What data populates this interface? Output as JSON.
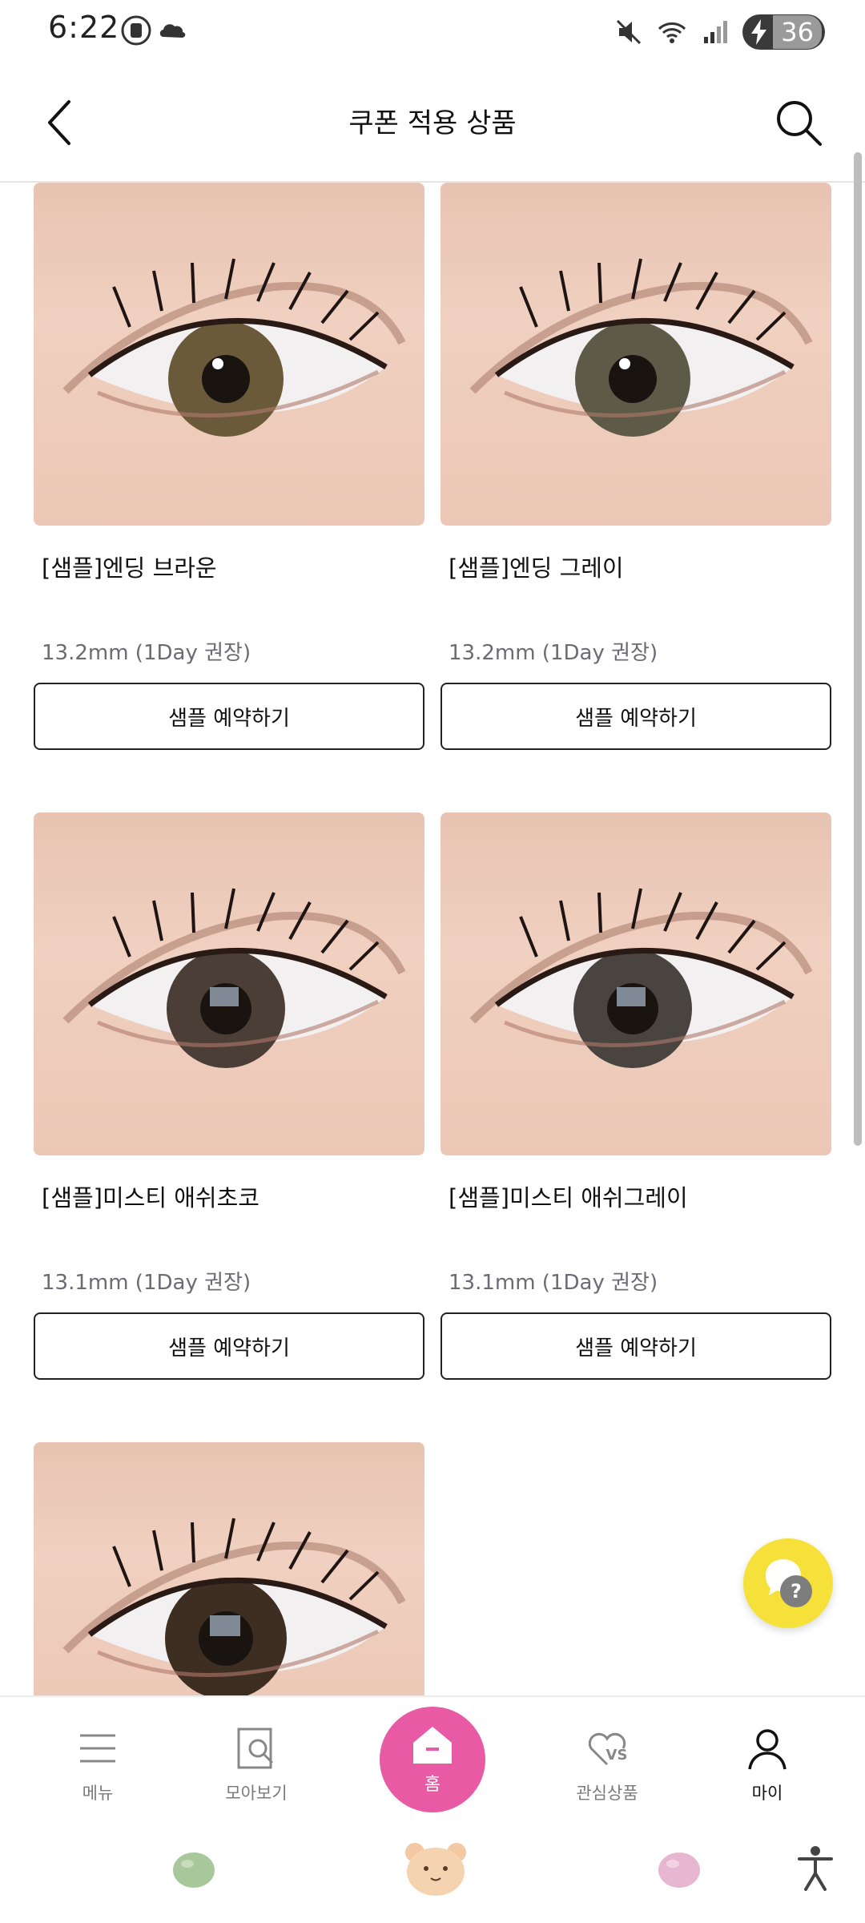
{
  "status_bar": {
    "time": "6:22",
    "battery_level": "36"
  },
  "header": {
    "title": "쿠폰 적용 상품",
    "back_icon": "chevron-left-icon",
    "search_icon": "search-icon"
  },
  "products": [
    {
      "name": "[샘플]엔딩 브라운",
      "spec": "13.2mm (1Day 권장)",
      "button": "샘플 예약하기",
      "iris_color": "#6b5a3a"
    },
    {
      "name": "[샘플]엔딩 그레이",
      "spec": "13.2mm (1Day 권장)",
      "button": "샘플 예약하기",
      "iris_color": "#5e5a48"
    },
    {
      "name": "[샘플]미스티 애쉬초코",
      "spec": "13.1mm (1Day 권장)",
      "button": "샘플 예약하기",
      "iris_color": "#4a3e36"
    },
    {
      "name": "[샘플]미스티 애쉬그레이",
      "spec": "13.1mm (1Day 권장)",
      "button": "샘플 예약하기",
      "iris_color": "#4a4440"
    },
    {
      "iris_color": "#3e2e22"
    }
  ],
  "bottom_nav": {
    "items": [
      {
        "label": "메뉴",
        "icon": "menu-icon"
      },
      {
        "label": "모아보기",
        "icon": "collection-search-icon"
      },
      {
        "label": "홈",
        "icon": "home-icon"
      },
      {
        "label": "관심상품",
        "icon": "heart-vs-icon"
      },
      {
        "label": "마이",
        "icon": "user-icon"
      }
    ]
  },
  "colors": {
    "home_accent": "#e95aa5",
    "chat_accent": "#f5e13a",
    "spec_text": "#6b6b73"
  }
}
